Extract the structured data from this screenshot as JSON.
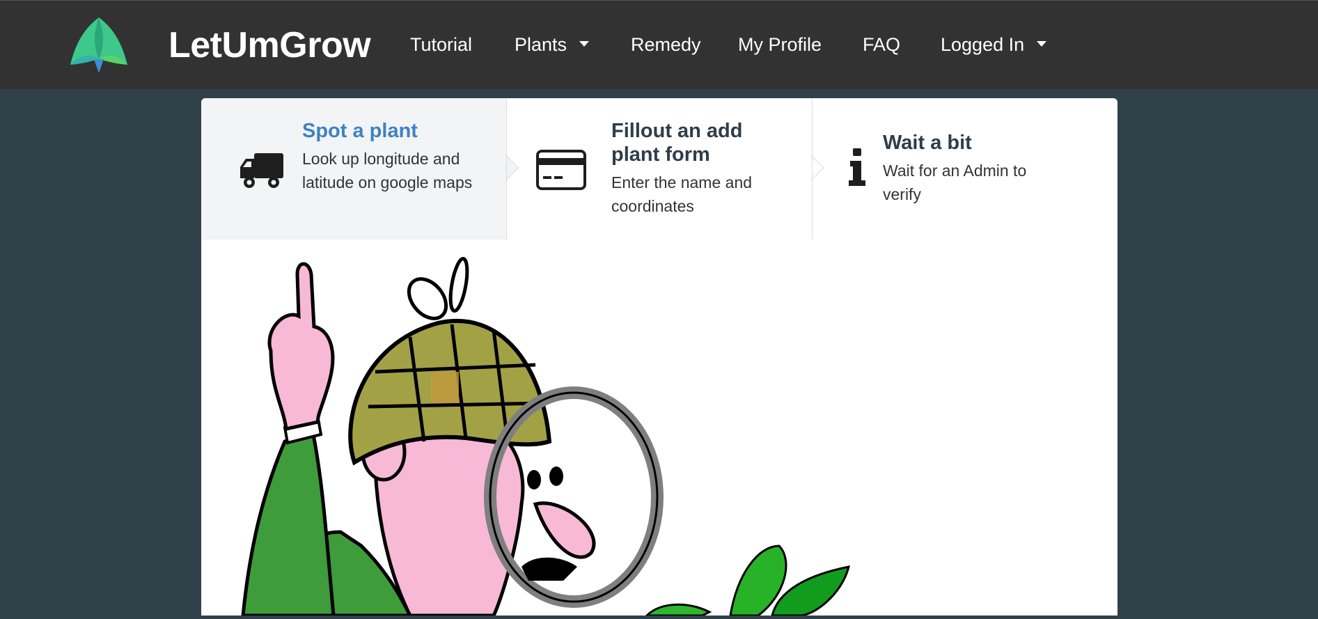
{
  "brand": {
    "name": "LetUmGrow"
  },
  "nav": {
    "tutorial": "Tutorial",
    "plants": "Plants",
    "remedy": "Remedy",
    "profile": "My Profile",
    "faq": "FAQ",
    "logged_in": "Logged In"
  },
  "steps": [
    {
      "title": "Spot a plant",
      "desc": "Look up longitude and latitude on google maps",
      "icon": "truck-icon",
      "active": true
    },
    {
      "title": "Fillout an add plant form",
      "desc": "Enter the name and coordinates",
      "icon": "credit-card-icon",
      "active": false
    },
    {
      "title": "Wait a bit",
      "desc": "Wait for an Admin to verify",
      "icon": "info-icon",
      "active": false
    }
  ],
  "illustration": {
    "subject": "detective-with-magnifier-and-plant"
  },
  "colors": {
    "nav_bg": "#323232",
    "page_bg": "#2f4049",
    "active_step_title": "#3d82c4",
    "logo_green": "#3ec98a"
  }
}
